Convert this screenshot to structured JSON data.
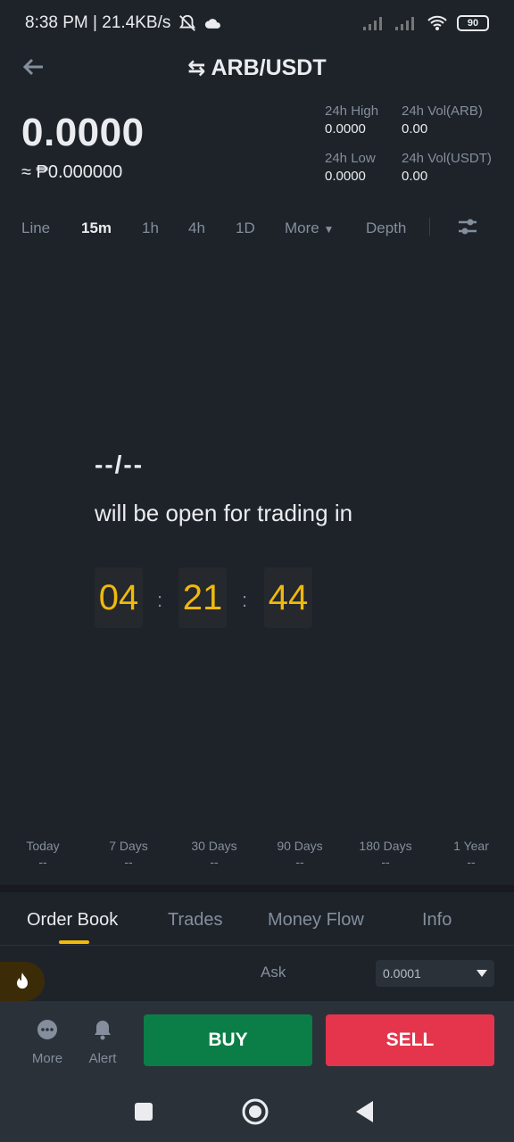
{
  "status": {
    "time_speed": "8:38 PM | 21.4KB/s",
    "battery": "90"
  },
  "header": {
    "pair": "ARB/USDT",
    "price": "0.0000",
    "approx": "≈ ₱0.000000"
  },
  "stats": {
    "high_label": "24h High",
    "high_value": "0.0000",
    "vol_base_label": "24h Vol(ARB)",
    "vol_base_value": "0.00",
    "low_label": "24h Low",
    "low_value": "0.0000",
    "vol_quote_label": "24h Vol(USDT)",
    "vol_quote_value": "0.00"
  },
  "timeframes": {
    "line": "Line",
    "m15": "15m",
    "h1": "1h",
    "h4": "4h",
    "d1": "1D",
    "more": "More",
    "depth": "Depth"
  },
  "countdown": {
    "title": "--/--",
    "subtitle": "will be open for trading in",
    "hours": "04",
    "minutes": "21",
    "seconds": "44",
    "sep": ":"
  },
  "performance": [
    {
      "label": "Today",
      "value": "--"
    },
    {
      "label": "7 Days",
      "value": "--"
    },
    {
      "label": "30 Days",
      "value": "--"
    },
    {
      "label": "90 Days",
      "value": "--"
    },
    {
      "label": "180 Days",
      "value": "--"
    },
    {
      "label": "1 Year",
      "value": "--"
    }
  ],
  "tabs": {
    "order_book": "Order Book",
    "trades": "Trades",
    "money_flow": "Money Flow",
    "info": "Info"
  },
  "orderbook": {
    "ask_label": "Ask",
    "precision": "0.0001"
  },
  "bottom": {
    "more": "More",
    "alert": "Alert",
    "buy": "BUY",
    "sell": "SELL"
  },
  "colors": {
    "background": "#1e2329",
    "accent": "#f0b90b",
    "buy": "#0b7e47",
    "sell": "#e4354d",
    "muted": "#848e9c"
  }
}
